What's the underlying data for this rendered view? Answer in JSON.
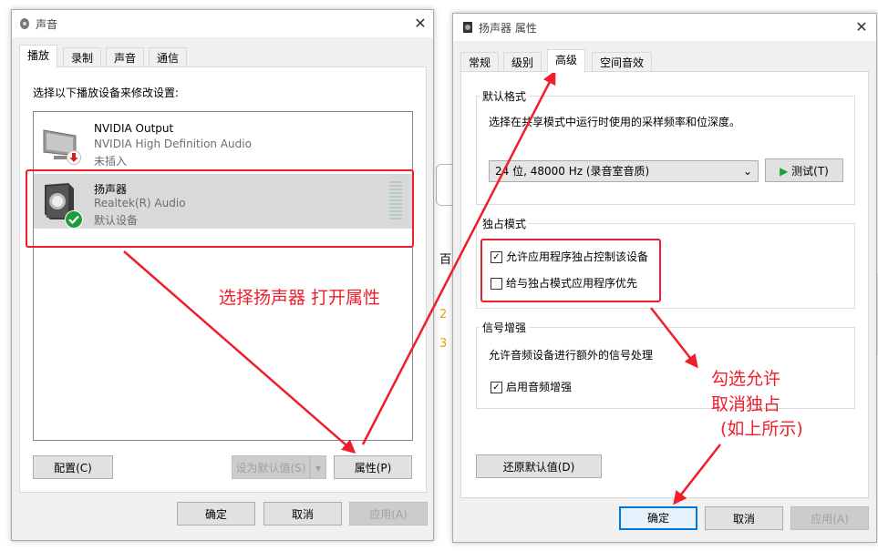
{
  "sound_window": {
    "title": "声音",
    "tabs": [
      "播放",
      "录制",
      "声音",
      "通信"
    ],
    "instruction": "选择以下播放设备来修改设置:",
    "devices": [
      {
        "name": "NVIDIA Output",
        "driver": "NVIDIA High Definition Audio",
        "status": "未插入"
      },
      {
        "name": "扬声器",
        "driver": "Realtek(R) Audio",
        "status": "默认设备"
      }
    ],
    "configure_button": "配置(C)",
    "set_default_button": "设为默认值(S)",
    "properties_button": "属性(P)",
    "ok_button": "确定",
    "cancel_button": "取消",
    "apply_button": "应用(A)"
  },
  "props_window": {
    "title": "扬声器 属性",
    "tabs": [
      "常规",
      "级别",
      "高级",
      "空间音效"
    ],
    "default_format": {
      "group_title": "默认格式",
      "description": "选择在共享模式中运行时使用的采样频率和位深度。",
      "selected": "24 位, 48000 Hz (录音室音质)",
      "test_button": "测试(T)"
    },
    "exclusive_mode": {
      "group_title": "独占模式",
      "allow_label": "允许应用程序独占控制该设备",
      "allow_checked": true,
      "priority_label": "给与独占模式应用程序优先",
      "priority_checked": false
    },
    "signal_enhancement": {
      "group_title": "信号增强",
      "description": "允许音频设备进行额外的信号处理",
      "enable_label": "启用音频增强",
      "enable_checked": true
    },
    "restore_button": "还原默认值(D)",
    "ok_button": "确定",
    "cancel_button": "取消",
    "apply_button": "应用(A)"
  },
  "background": {
    "fragment_text": "百",
    "numbers": [
      "2",
      "3"
    ]
  },
  "annotations": {
    "select_speaker": "选择扬声器 打开属性",
    "check_line1": "勾选允许",
    "check_line2": "取消独占",
    "check_line3": "(如上所示)"
  },
  "colors": {
    "annotation_red": "#f01d2a",
    "selection_gray": "#d9d9d9",
    "accent_blue": "#0078d7",
    "green_check": "#1e9e3a"
  }
}
